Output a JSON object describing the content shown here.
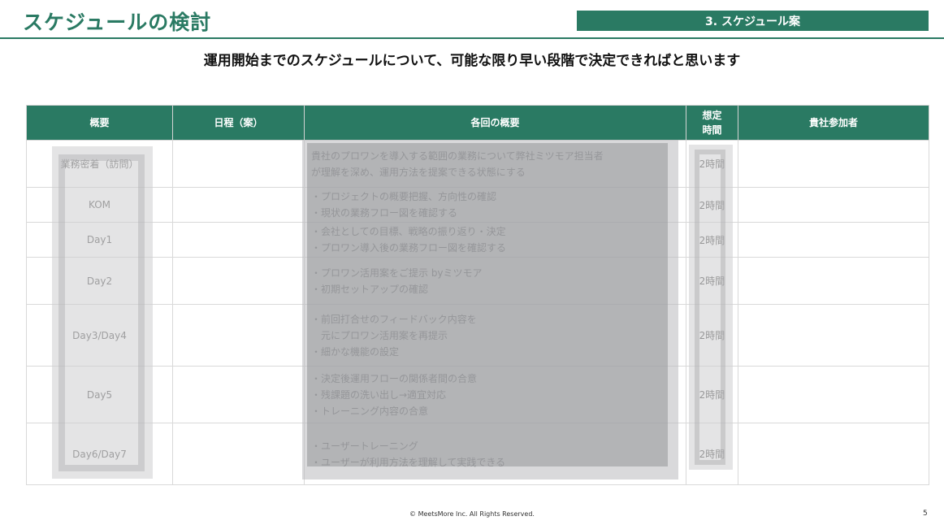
{
  "header": {
    "title": "スケジュールの検討",
    "section_tag": "3. スケジュール案"
  },
  "subtitle": "運用開始までのスケジュールについて、可能な限り早い段階で決定できればと思います",
  "table": {
    "headers": [
      "概要",
      "日程（案）",
      "各回の概要",
      "想定時間",
      "貴社参加者"
    ],
    "time_header_lines": [
      "想定",
      "時間"
    ],
    "rows": [
      {
        "outline": "業務密着（訪問）",
        "date": "",
        "desc": [
          "貴社のプロワンを導入する範囲の業務について弊社ミツモア担当者",
          "が理解を深め、運用方法を提案できる状態にする"
        ],
        "time": "2時間",
        "participants": ""
      },
      {
        "outline": "KOM",
        "date": "",
        "desc": [
          "・プロジェクトの概要把握、方向性の確認",
          "・現状の業務フロー図を確認する"
        ],
        "time": "2時間",
        "participants": ""
      },
      {
        "outline": "Day1",
        "date": "",
        "desc": [
          "・会社としての目標、戦略の振り返り・決定",
          "・プロワン導入後の業務フロー図を確認する"
        ],
        "time": "2時間",
        "participants": ""
      },
      {
        "outline": "Day2",
        "date": "",
        "desc": [
          "・プロワン活用案をご提示 byミツモア",
          "・初期セットアップの確認"
        ],
        "time": "2時間",
        "participants": ""
      },
      {
        "outline": "Day3/Day4",
        "date": "",
        "desc": [
          "・前回打合せのフィードバック内容を",
          "　元にプロワン活用案を再提示",
          "・細かな機能の設定"
        ],
        "time": "2時間",
        "participants": ""
      },
      {
        "outline": "Day5",
        "date": "",
        "desc": [
          "・決定後運用フローの関係者間の合意",
          "・残課題の洗い出し→適宜対応",
          "・トレーニング内容の合意"
        ],
        "time": "2時間",
        "participants": ""
      },
      {
        "outline": "Day6/Day7",
        "date": "",
        "desc": [
          "・ユーザートレーニング",
          "・ユーザーが利用方法を理解して実践できる"
        ],
        "time": "2時間",
        "participants": ""
      }
    ]
  },
  "footer": {
    "copyright": "© MeetsMore Inc. All Rights Reserved.",
    "page_number": "5"
  },
  "colors": {
    "accent": "#2a7a63",
    "redaction": "#a7a8ab"
  }
}
